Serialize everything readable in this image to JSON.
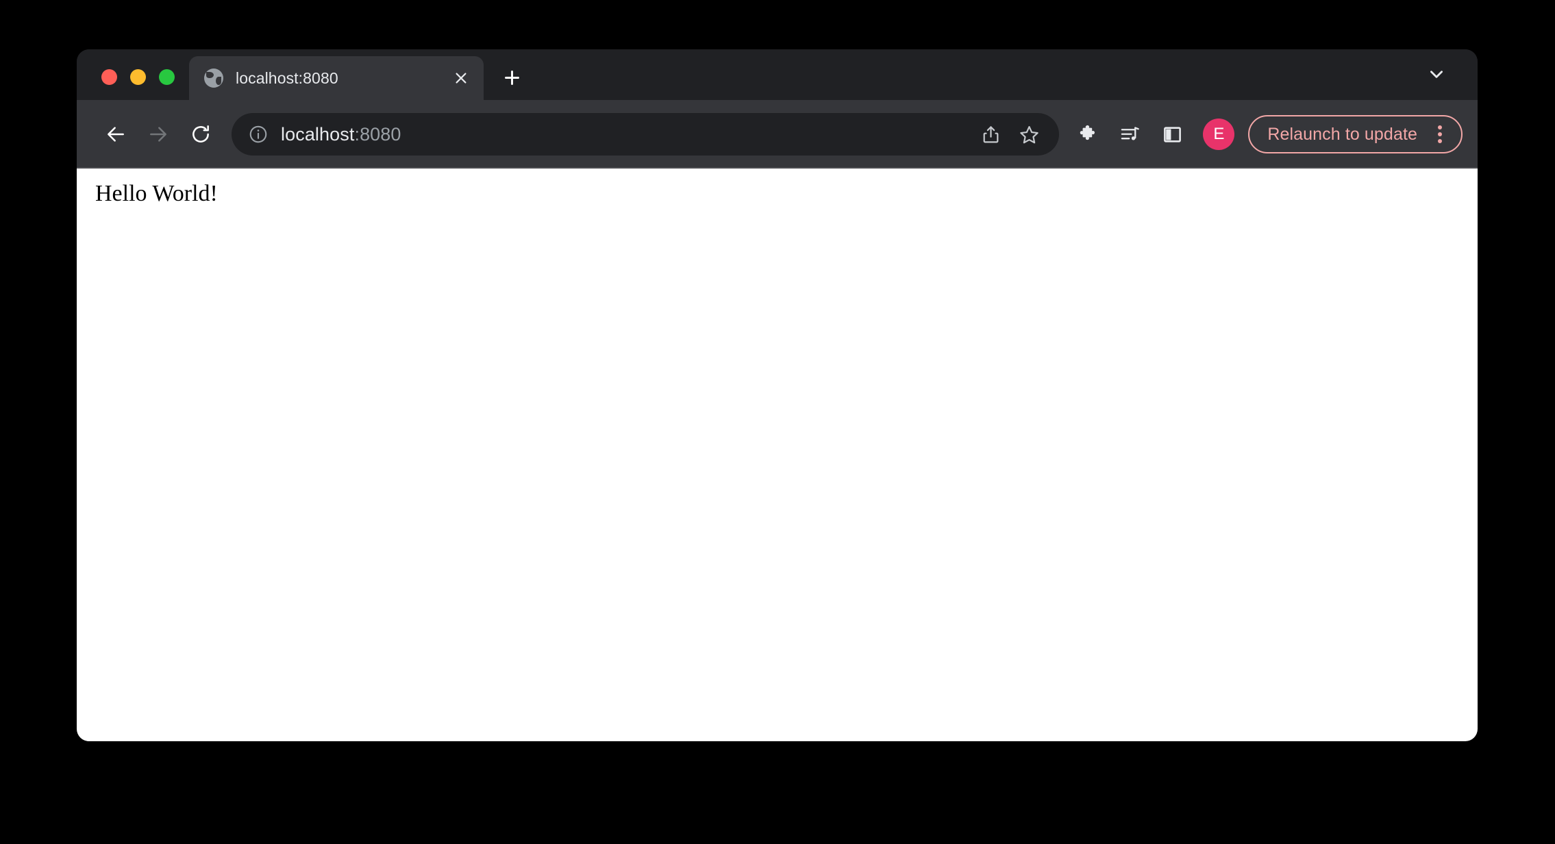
{
  "window": {
    "traffic_lights": [
      {
        "name": "close",
        "color": "#ff5f57"
      },
      {
        "name": "minimize",
        "color": "#febc2e"
      },
      {
        "name": "maximize",
        "color": "#28c840"
      }
    ]
  },
  "tab_strip": {
    "tabs": [
      {
        "title": "localhost:8080",
        "favicon": "globe-icon",
        "close_icon": "close-icon",
        "active": true
      }
    ],
    "new_tab_icon": "plus-icon",
    "tab_search_icon": "chevron-down-icon"
  },
  "toolbar": {
    "back_icon": "arrow-left-icon",
    "forward_icon": "arrow-right-icon",
    "reload_icon": "reload-icon",
    "omnibox": {
      "site_info_icon": "info-circle-icon",
      "url_host": "localhost",
      "url_suffix": ":8080",
      "share_icon": "share-icon",
      "bookmark_icon": "star-icon"
    },
    "actions": [
      {
        "name": "extensions",
        "icon": "puzzle-icon"
      },
      {
        "name": "media-controls",
        "icon": "media-list-icon"
      },
      {
        "name": "side-panel",
        "icon": "side-panel-icon"
      }
    ],
    "profile": {
      "initial": "E",
      "color": "#e8336a"
    },
    "relaunch": {
      "label": "Relaunch to update",
      "menu_icon": "three-dots-icon",
      "color": "#f2a7a7"
    }
  },
  "page": {
    "heading": "Hello World!",
    "background": "#ffffff"
  }
}
